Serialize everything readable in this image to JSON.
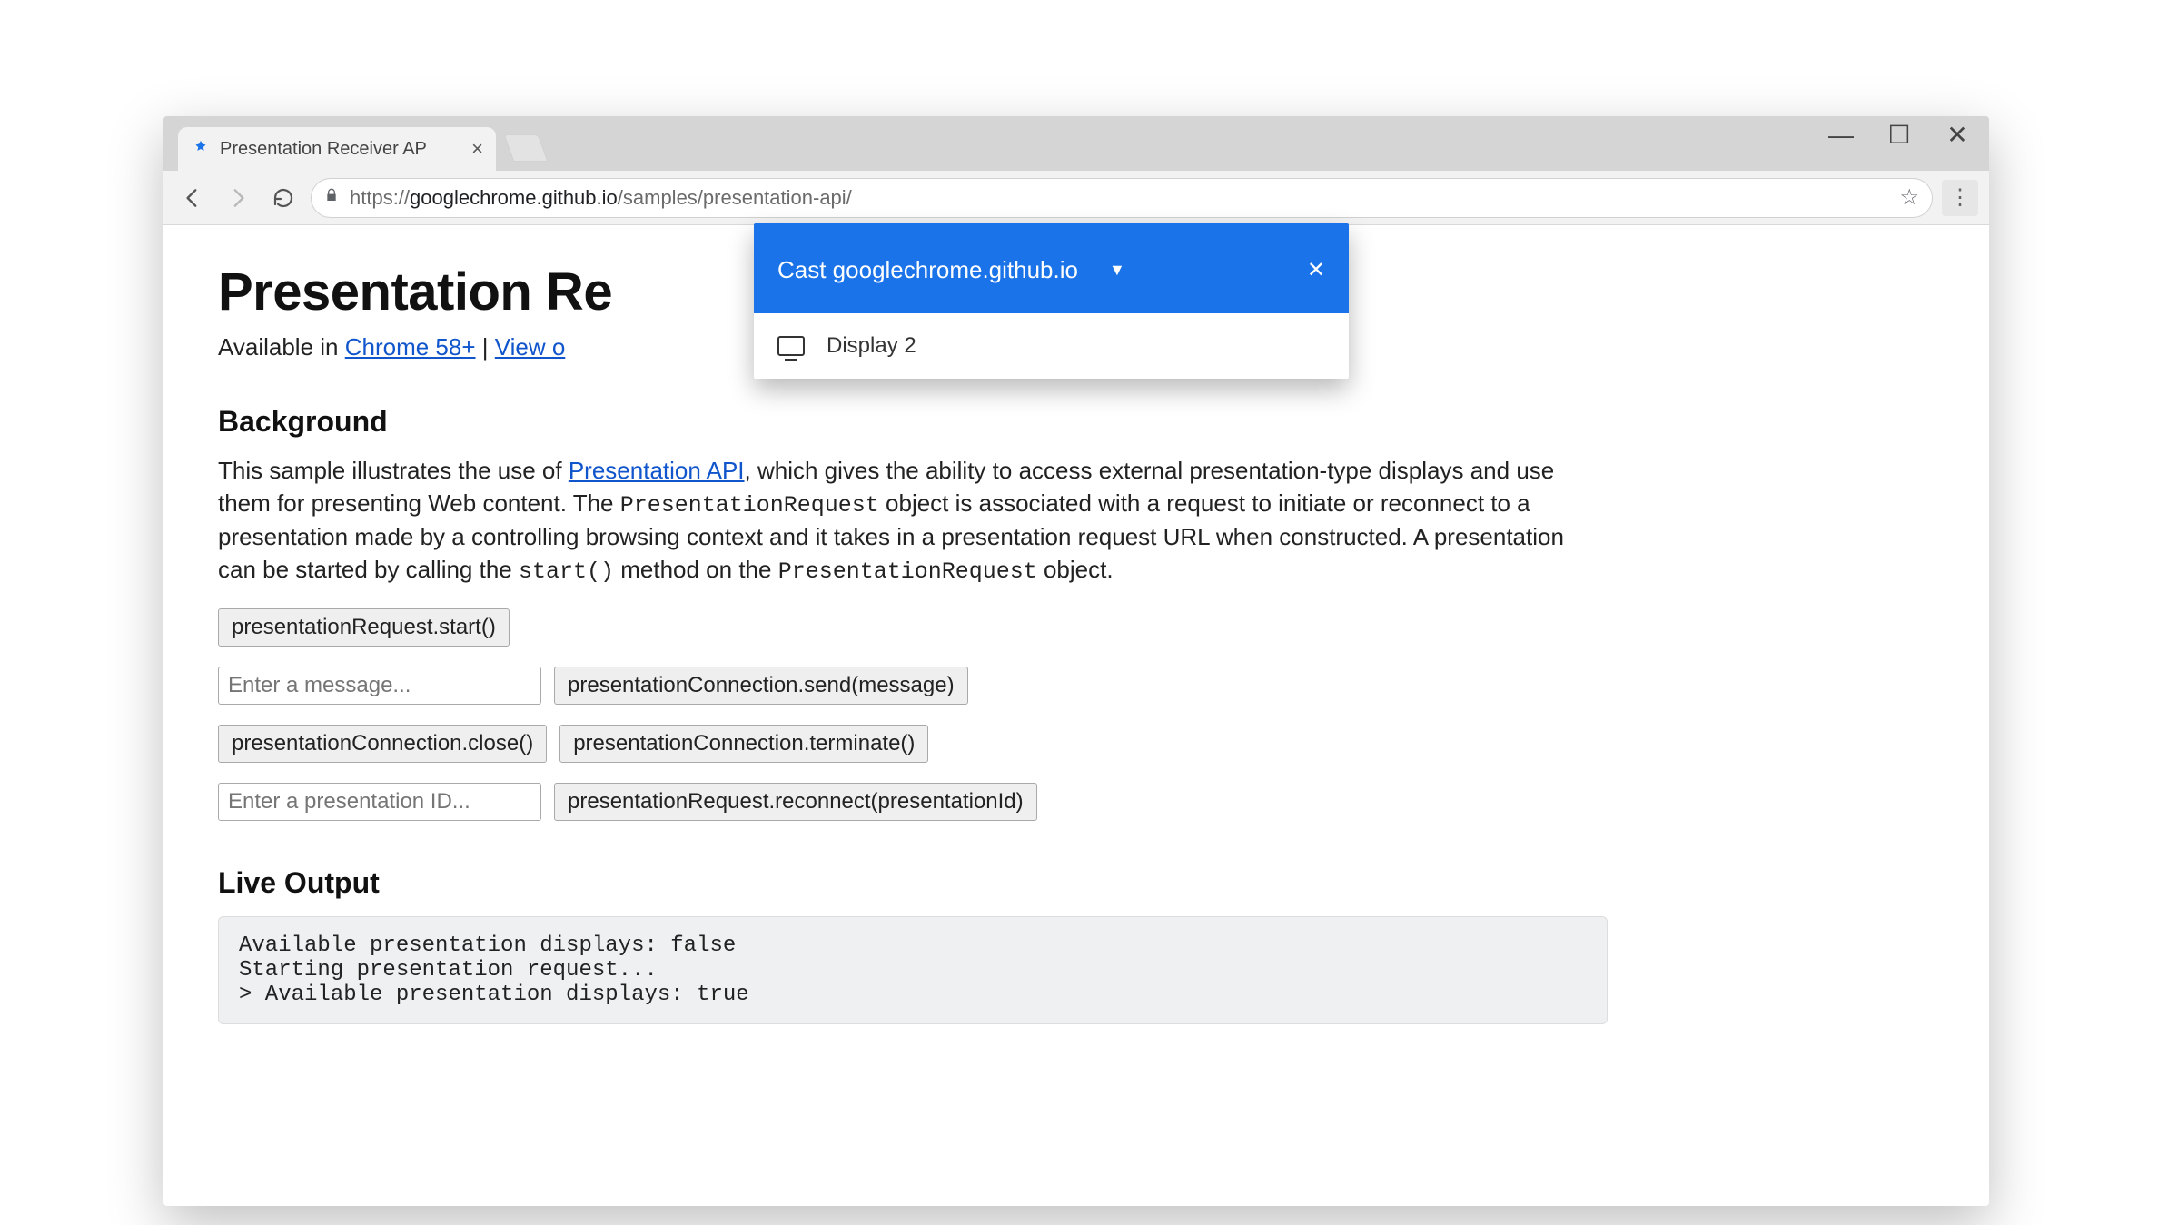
{
  "window": {
    "tab_title": "Presentation Receiver AP",
    "minimize": "—",
    "maximize": "☐",
    "close": "✕"
  },
  "toolbar": {
    "url_scheme": "https://",
    "url_host": "googlechrome.github.io",
    "url_path": "/samples/presentation-api/"
  },
  "page": {
    "h1": "Presentation Re",
    "sub_prefix": "Available in ",
    "sub_link1": "Chrome 58+",
    "sub_sep": " | ",
    "sub_link2": "View o",
    "h2_bg": "Background",
    "para_a": "This sample illustrates the use of ",
    "para_link": "Presentation API",
    "para_b": ", which gives the ability to access external presentation-type displays and use them for presenting Web content. The ",
    "code1": "PresentationRequest",
    "para_c": " object is associated with a request to initiate or reconnect to a presentation made by a controlling browsing context and it takes in a presentation request URL when constructed. A presentation can be started by calling the ",
    "code2": "start()",
    "para_d": " method on the ",
    "code3": "PresentationRequest",
    "para_e": " object.",
    "btn_start": "presentationRequest.start()",
    "input_msg_ph": "Enter a message...",
    "btn_send": "presentationConnection.send(message)",
    "btn_close": "presentationConnection.close()",
    "btn_term": "presentationConnection.terminate()",
    "input_id_ph": "Enter a presentation ID...",
    "btn_recon": "presentationRequest.reconnect(presentationId)",
    "h2_out": "Live Output",
    "output": "Available presentation displays: false\nStarting presentation request...\n> Available presentation displays: true"
  },
  "cast": {
    "title": "Cast googlechrome.github.io",
    "device": "Display 2"
  }
}
